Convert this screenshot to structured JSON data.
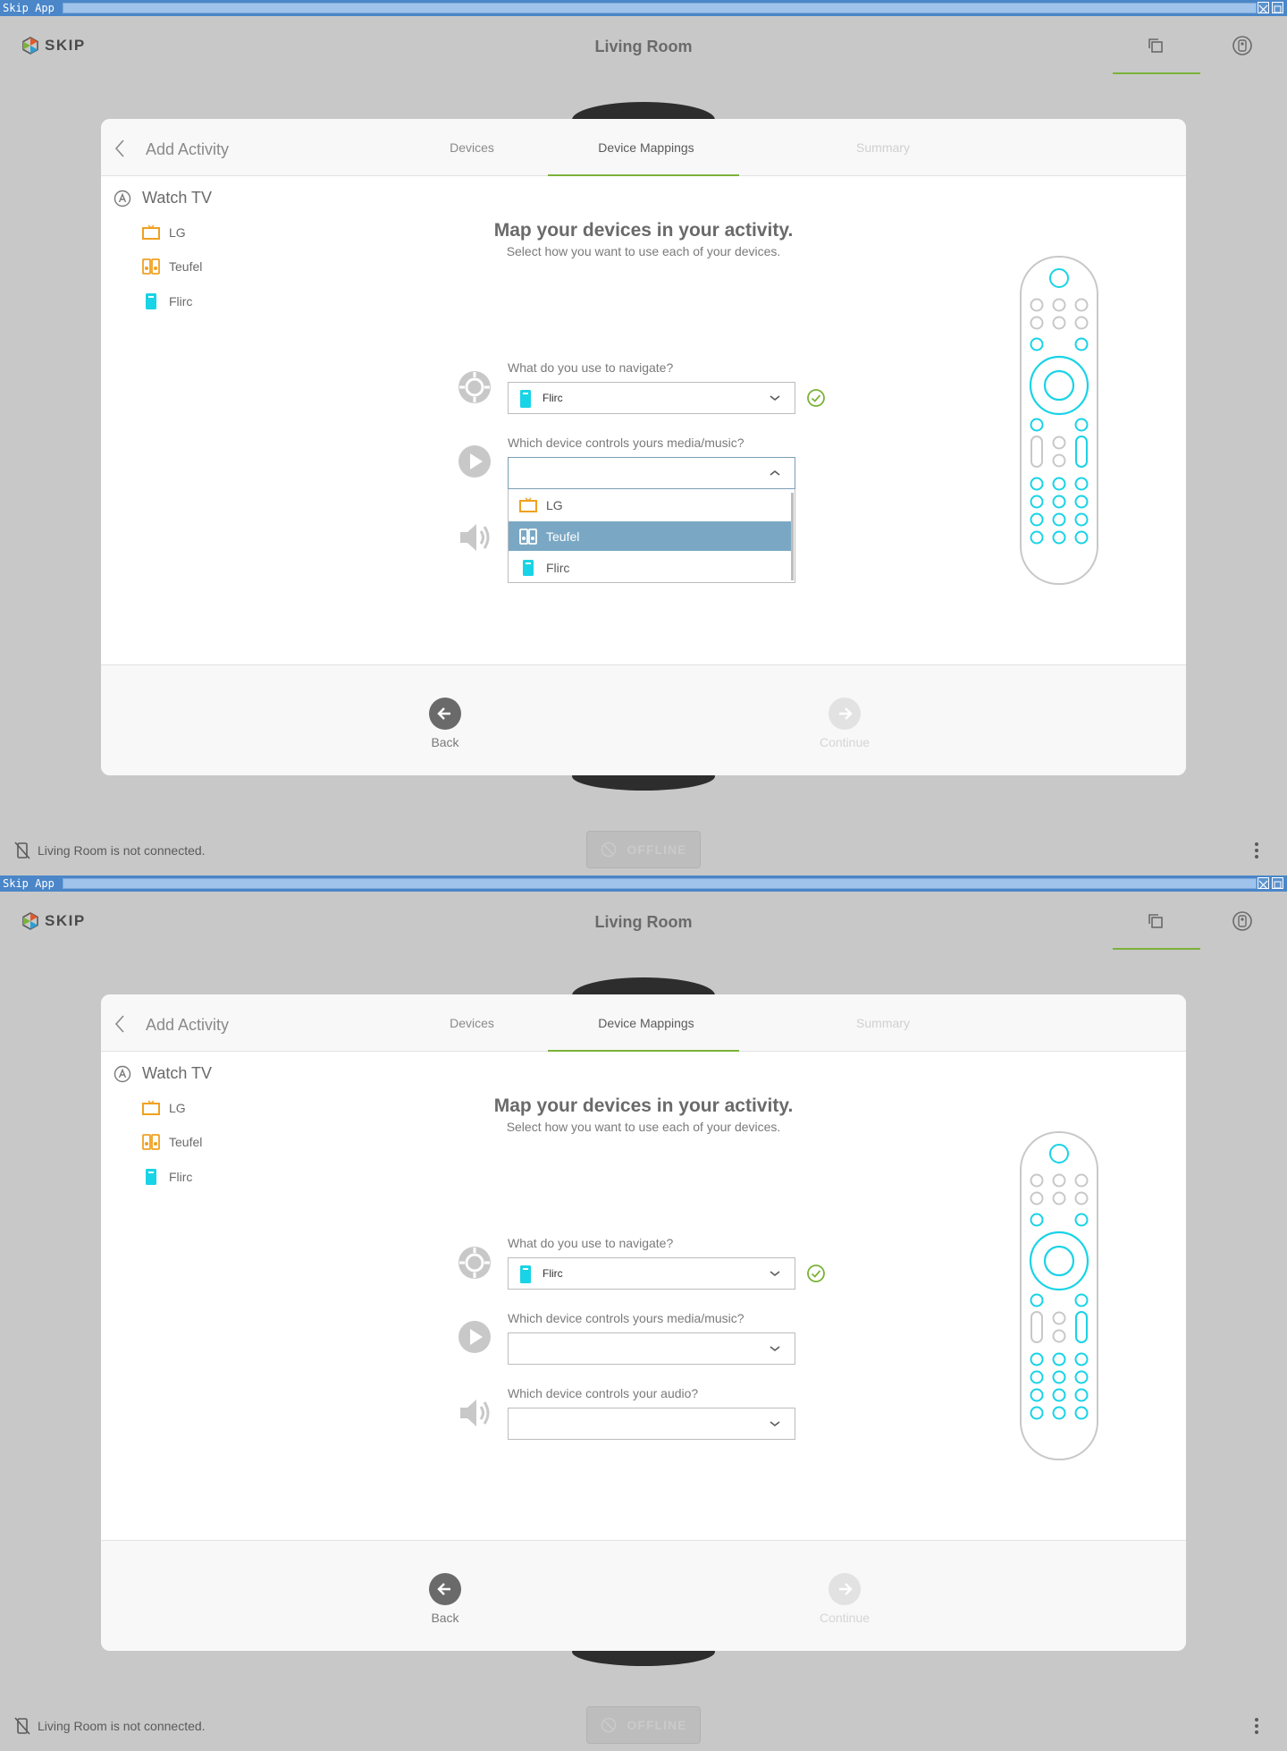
{
  "window": {
    "title": "Skip App"
  },
  "app": {
    "logo_text": "SKIP",
    "room_title": "Living Room"
  },
  "wizard": {
    "back_label": "Add Activity",
    "tabs": [
      {
        "label": "Devices"
      },
      {
        "label": "Device Mappings"
      },
      {
        "label": "Summary"
      }
    ],
    "activity_name": "Watch TV",
    "devices": [
      {
        "name": "LG",
        "icon": "tv-icon",
        "color": "#f0a020"
      },
      {
        "name": "Teufel",
        "icon": "speaker-icon",
        "color": "#f0a020"
      },
      {
        "name": "Flirc",
        "icon": "remote-device-icon",
        "color": "#19d3e6"
      }
    ],
    "heading": "Map your devices in your activity.",
    "subheading": "Select how you want to use each of your devices.",
    "questions": {
      "navigate": {
        "label": "What do you use to navigate?",
        "value": "Flirc"
      },
      "media": {
        "label": "Which device controls yours media/music?",
        "value": ""
      },
      "audio": {
        "label": "Which device controls your audio?",
        "value": ""
      }
    },
    "dropdown_options": [
      {
        "name": "LG"
      },
      {
        "name": "Teufel"
      },
      {
        "name": "Flirc"
      }
    ],
    "dropdown_highlighted": "Teufel",
    "footer": {
      "back_label": "Back",
      "continue_label": "Continue"
    }
  },
  "status": {
    "message": "Living Room is not connected.",
    "offline_label": "OFFLINE"
  },
  "colors": {
    "accent": "#7bb23a",
    "cyan": "#19d3e6",
    "highlight": "#7aa8c4"
  }
}
